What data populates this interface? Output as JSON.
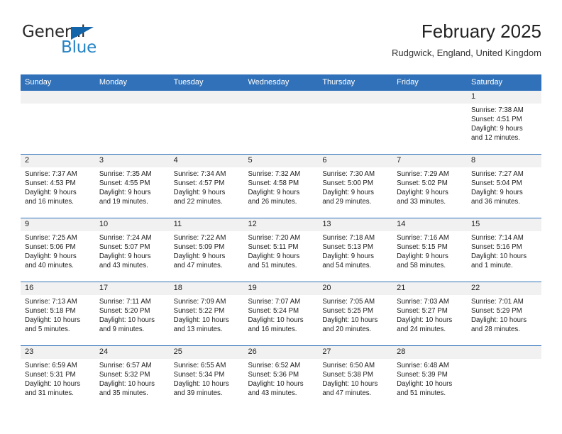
{
  "brand": {
    "name_top": "General",
    "name_bottom": "Blue",
    "triangle_icon": "blue-triangle-logo-mark",
    "accent_color": "#1464aa",
    "text_color": "#2483c5"
  },
  "header": {
    "title": "February 2025",
    "subtitle": "Rudgwick, England, United Kingdom"
  },
  "calendar": {
    "header_background": "#3071b9",
    "header_text_color": "#ffffff",
    "daynum_strip_background": "#f1f1f1",
    "weekdays": [
      "Sunday",
      "Monday",
      "Tuesday",
      "Wednesday",
      "Thursday",
      "Friday",
      "Saturday"
    ],
    "weeks": [
      [
        {
          "day": "",
          "empty": true
        },
        {
          "day": "",
          "empty": true
        },
        {
          "day": "",
          "empty": true
        },
        {
          "day": "",
          "empty": true
        },
        {
          "day": "",
          "empty": true
        },
        {
          "day": "",
          "empty": true
        },
        {
          "day": "1",
          "sunrise": "Sunrise: 7:38 AM",
          "sunset": "Sunset: 4:51 PM",
          "daylight_line1": "Daylight: 9 hours",
          "daylight_line2": "and 12 minutes."
        }
      ],
      [
        {
          "day": "2",
          "sunrise": "Sunrise: 7:37 AM",
          "sunset": "Sunset: 4:53 PM",
          "daylight_line1": "Daylight: 9 hours",
          "daylight_line2": "and 16 minutes."
        },
        {
          "day": "3",
          "sunrise": "Sunrise: 7:35 AM",
          "sunset": "Sunset: 4:55 PM",
          "daylight_line1": "Daylight: 9 hours",
          "daylight_line2": "and 19 minutes."
        },
        {
          "day": "4",
          "sunrise": "Sunrise: 7:34 AM",
          "sunset": "Sunset: 4:57 PM",
          "daylight_line1": "Daylight: 9 hours",
          "daylight_line2": "and 22 minutes."
        },
        {
          "day": "5",
          "sunrise": "Sunrise: 7:32 AM",
          "sunset": "Sunset: 4:58 PM",
          "daylight_line1": "Daylight: 9 hours",
          "daylight_line2": "and 26 minutes."
        },
        {
          "day": "6",
          "sunrise": "Sunrise: 7:30 AM",
          "sunset": "Sunset: 5:00 PM",
          "daylight_line1": "Daylight: 9 hours",
          "daylight_line2": "and 29 minutes."
        },
        {
          "day": "7",
          "sunrise": "Sunrise: 7:29 AM",
          "sunset": "Sunset: 5:02 PM",
          "daylight_line1": "Daylight: 9 hours",
          "daylight_line2": "and 33 minutes."
        },
        {
          "day": "8",
          "sunrise": "Sunrise: 7:27 AM",
          "sunset": "Sunset: 5:04 PM",
          "daylight_line1": "Daylight: 9 hours",
          "daylight_line2": "and 36 minutes."
        }
      ],
      [
        {
          "day": "9",
          "sunrise": "Sunrise: 7:25 AM",
          "sunset": "Sunset: 5:06 PM",
          "daylight_line1": "Daylight: 9 hours",
          "daylight_line2": "and 40 minutes."
        },
        {
          "day": "10",
          "sunrise": "Sunrise: 7:24 AM",
          "sunset": "Sunset: 5:07 PM",
          "daylight_line1": "Daylight: 9 hours",
          "daylight_line2": "and 43 minutes."
        },
        {
          "day": "11",
          "sunrise": "Sunrise: 7:22 AM",
          "sunset": "Sunset: 5:09 PM",
          "daylight_line1": "Daylight: 9 hours",
          "daylight_line2": "and 47 minutes."
        },
        {
          "day": "12",
          "sunrise": "Sunrise: 7:20 AM",
          "sunset": "Sunset: 5:11 PM",
          "daylight_line1": "Daylight: 9 hours",
          "daylight_line2": "and 51 minutes."
        },
        {
          "day": "13",
          "sunrise": "Sunrise: 7:18 AM",
          "sunset": "Sunset: 5:13 PM",
          "daylight_line1": "Daylight: 9 hours",
          "daylight_line2": "and 54 minutes."
        },
        {
          "day": "14",
          "sunrise": "Sunrise: 7:16 AM",
          "sunset": "Sunset: 5:15 PM",
          "daylight_line1": "Daylight: 9 hours",
          "daylight_line2": "and 58 minutes."
        },
        {
          "day": "15",
          "sunrise": "Sunrise: 7:14 AM",
          "sunset": "Sunset: 5:16 PM",
          "daylight_line1": "Daylight: 10 hours",
          "daylight_line2": "and 1 minute."
        }
      ],
      [
        {
          "day": "16",
          "sunrise": "Sunrise: 7:13 AM",
          "sunset": "Sunset: 5:18 PM",
          "daylight_line1": "Daylight: 10 hours",
          "daylight_line2": "and 5 minutes."
        },
        {
          "day": "17",
          "sunrise": "Sunrise: 7:11 AM",
          "sunset": "Sunset: 5:20 PM",
          "daylight_line1": "Daylight: 10 hours",
          "daylight_line2": "and 9 minutes."
        },
        {
          "day": "18",
          "sunrise": "Sunrise: 7:09 AM",
          "sunset": "Sunset: 5:22 PM",
          "daylight_line1": "Daylight: 10 hours",
          "daylight_line2": "and 13 minutes."
        },
        {
          "day": "19",
          "sunrise": "Sunrise: 7:07 AM",
          "sunset": "Sunset: 5:24 PM",
          "daylight_line1": "Daylight: 10 hours",
          "daylight_line2": "and 16 minutes."
        },
        {
          "day": "20",
          "sunrise": "Sunrise: 7:05 AM",
          "sunset": "Sunset: 5:25 PM",
          "daylight_line1": "Daylight: 10 hours",
          "daylight_line2": "and 20 minutes."
        },
        {
          "day": "21",
          "sunrise": "Sunrise: 7:03 AM",
          "sunset": "Sunset: 5:27 PM",
          "daylight_line1": "Daylight: 10 hours",
          "daylight_line2": "and 24 minutes."
        },
        {
          "day": "22",
          "sunrise": "Sunrise: 7:01 AM",
          "sunset": "Sunset: 5:29 PM",
          "daylight_line1": "Daylight: 10 hours",
          "daylight_line2": "and 28 minutes."
        }
      ],
      [
        {
          "day": "23",
          "sunrise": "Sunrise: 6:59 AM",
          "sunset": "Sunset: 5:31 PM",
          "daylight_line1": "Daylight: 10 hours",
          "daylight_line2": "and 31 minutes."
        },
        {
          "day": "24",
          "sunrise": "Sunrise: 6:57 AM",
          "sunset": "Sunset: 5:32 PM",
          "daylight_line1": "Daylight: 10 hours",
          "daylight_line2": "and 35 minutes."
        },
        {
          "day": "25",
          "sunrise": "Sunrise: 6:55 AM",
          "sunset": "Sunset: 5:34 PM",
          "daylight_line1": "Daylight: 10 hours",
          "daylight_line2": "and 39 minutes."
        },
        {
          "day": "26",
          "sunrise": "Sunrise: 6:52 AM",
          "sunset": "Sunset: 5:36 PM",
          "daylight_line1": "Daylight: 10 hours",
          "daylight_line2": "and 43 minutes."
        },
        {
          "day": "27",
          "sunrise": "Sunrise: 6:50 AM",
          "sunset": "Sunset: 5:38 PM",
          "daylight_line1": "Daylight: 10 hours",
          "daylight_line2": "and 47 minutes."
        },
        {
          "day": "28",
          "sunrise": "Sunrise: 6:48 AM",
          "sunset": "Sunset: 5:39 PM",
          "daylight_line1": "Daylight: 10 hours",
          "daylight_line2": "and 51 minutes."
        },
        {
          "day": "",
          "empty": true
        }
      ]
    ]
  }
}
